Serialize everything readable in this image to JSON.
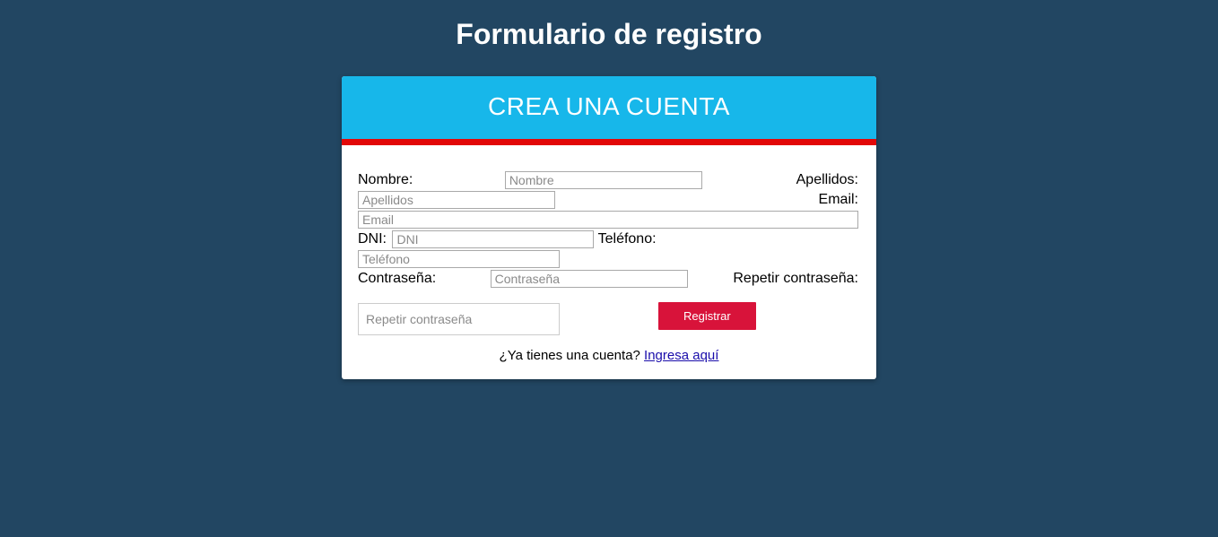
{
  "page": {
    "title": "Formulario de registro"
  },
  "card": {
    "header": "CREA UNA CUENTA"
  },
  "labels": {
    "nombre": "Nombre:",
    "apellidos": "Apellidos:",
    "email": "Email:",
    "dni": "DNI:",
    "telefono": "Teléfono:",
    "contrasena": "Contraseña:",
    "repetir": "Repetir contraseña:"
  },
  "placeholders": {
    "nombre": "Nombre",
    "apellidos": "Apellidos",
    "email": "Email",
    "dni": "DNI",
    "telefono": "Teléfono",
    "contrasena": "Contraseña",
    "repetir": "Repetir contraseña"
  },
  "values": {
    "nombre": "",
    "apellidos": "",
    "email": "",
    "dni": "",
    "telefono": "",
    "contrasena": "",
    "repetir": ""
  },
  "buttons": {
    "register": "Registrar"
  },
  "login": {
    "question": "¿Ya tienes una cuenta? ",
    "link_text": "Ingresa aquí"
  },
  "colors": {
    "background": "#224662",
    "header_bg": "#17b7ea",
    "accent_red": "#e20808",
    "button_bg": "#d8133a"
  }
}
